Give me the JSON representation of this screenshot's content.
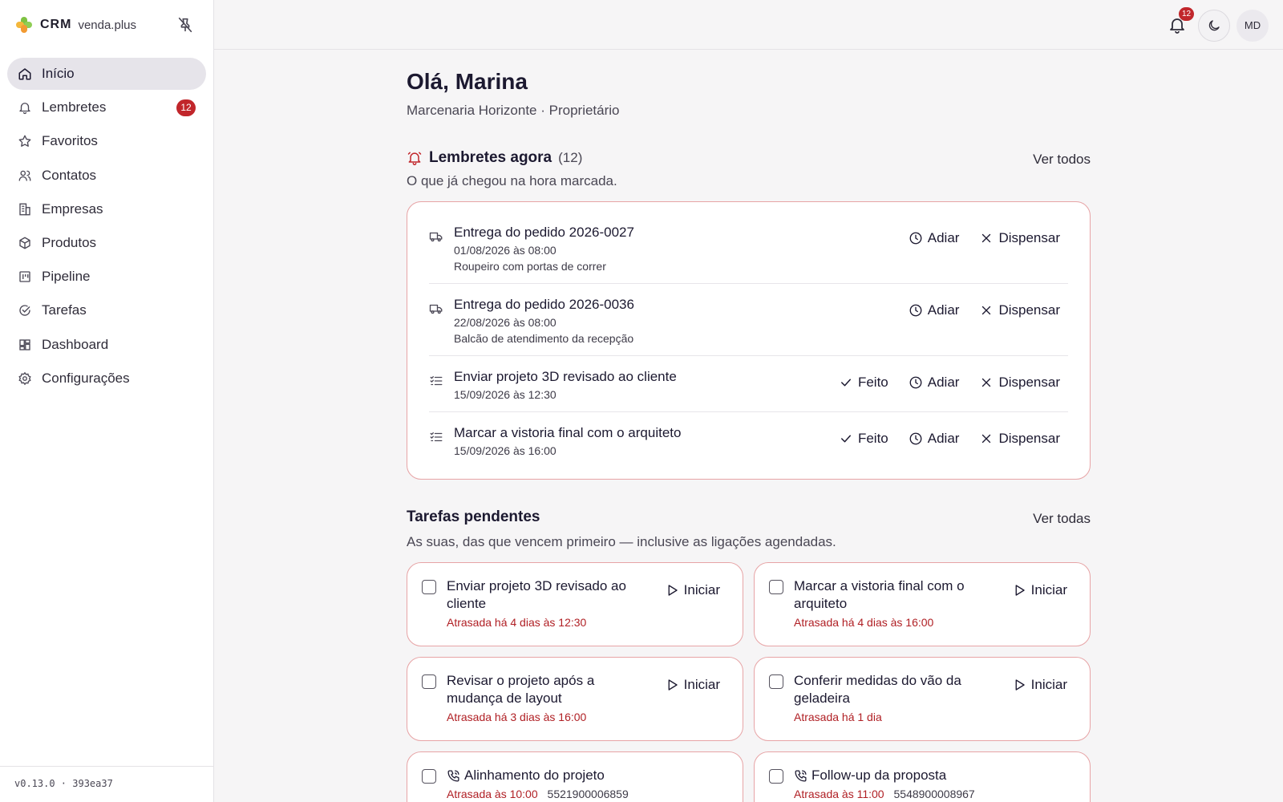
{
  "brand": {
    "name": "CRM",
    "site": "venda.plus"
  },
  "nav": {
    "items": [
      {
        "label": "Início",
        "icon": "home-icon",
        "active": true
      },
      {
        "label": "Lembretes",
        "icon": "bell-icon",
        "badge": "12"
      },
      {
        "label": "Favoritos",
        "icon": "star-icon"
      },
      {
        "label": "Contatos",
        "icon": "users-icon"
      },
      {
        "label": "Empresas",
        "icon": "building-icon"
      },
      {
        "label": "Produtos",
        "icon": "package-icon"
      },
      {
        "label": "Pipeline",
        "icon": "kanban-icon"
      },
      {
        "label": "Tarefas",
        "icon": "check-circle-icon"
      },
      {
        "label": "Dashboard",
        "icon": "dashboard-icon"
      },
      {
        "label": "Configurações",
        "icon": "gear-icon"
      }
    ]
  },
  "version": "v0.13.0 · 393ea37",
  "topbar": {
    "notifications": "12",
    "avatar": "MD"
  },
  "greeting": "Olá, Marina",
  "subtitle": "Marcenaria Horizonte · Proprietário",
  "reminders": {
    "title": "Lembretes agora",
    "count": "(12)",
    "link": "Ver todos",
    "description": "O que já chegou na hora marcada.",
    "items": [
      {
        "icon": "truck-icon",
        "title": "Entrega do pedido 2026-0027",
        "date": "01/08/2026 às 08:00",
        "desc": "Roupeiro com portas de correr",
        "done": "",
        "snooze": "Adiar",
        "dismiss": "Dispensar"
      },
      {
        "icon": "truck-icon",
        "title": "Entrega do pedido 2026-0036",
        "date": "22/08/2026 às 08:00",
        "desc": "Balcão de atendimento da recepção",
        "done": "",
        "snooze": "Adiar",
        "dismiss": "Dispensar"
      },
      {
        "icon": "task-list-icon",
        "title": "Enviar projeto 3D revisado ao cliente",
        "date": "15/09/2026 às 12:30",
        "desc": "",
        "done": "Feito",
        "snooze": "Adiar",
        "dismiss": "Dispensar"
      },
      {
        "icon": "task-list-icon",
        "title": "Marcar a vistoria final com o arquiteto",
        "date": "15/09/2026 às 16:00",
        "desc": "",
        "done": "Feito",
        "snooze": "Adiar",
        "dismiss": "Dispensar"
      }
    ]
  },
  "tasks": {
    "title": "Tarefas pendentes",
    "link": "Ver todas",
    "description": "As suas, das que vencem primeiro — inclusive as ligações agendadas.",
    "items": [
      {
        "title": "Enviar projeto 3D revisado ao cliente",
        "late": "Atrasada há 4 dias às 12:30",
        "action": "Iniciar"
      },
      {
        "title": "Marcar a vistoria final com o arquiteto",
        "late": "Atrasada há 4 dias às 16:00",
        "action": "Iniciar"
      },
      {
        "title": "Revisar o projeto após a mudança de layout",
        "late": "Atrasada há 3 dias às 16:00",
        "action": "Iniciar"
      },
      {
        "title": "Conferir medidas do vão da geladeira",
        "late": "Atrasada há 1 dia",
        "action": "Iniciar"
      }
    ],
    "calls": [
      {
        "title": "Alinhamento do projeto",
        "late": "Atrasada às 10:00",
        "phone": "5521900006859"
      },
      {
        "title": "Follow-up da proposta",
        "late": "Atrasada às 11:00",
        "phone": "5548900008967"
      }
    ]
  },
  "colors": {
    "accent_red": "#c1262b",
    "card_border": "#e7a4a6",
    "late_text": "#b01f24"
  }
}
